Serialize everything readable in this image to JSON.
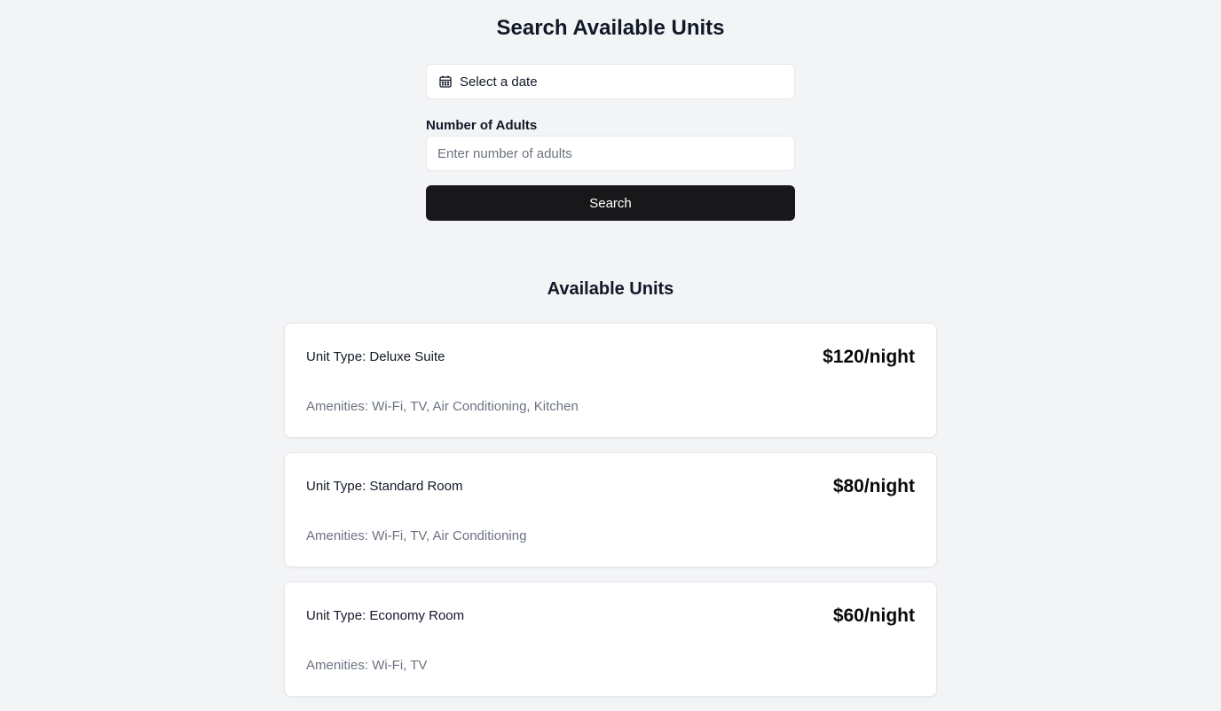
{
  "header": {
    "title": "Search Available Units"
  },
  "search": {
    "date_label": "Select a date",
    "adults_label": "Number of Adults",
    "adults_placeholder": "Enter number of adults",
    "adults_value": "",
    "button_label": "Search"
  },
  "results": {
    "title": "Available Units",
    "units": [
      {
        "type": "Unit Type: Deluxe Suite",
        "price": "$120/night",
        "amenities": "Amenities: Wi-Fi, TV, Air Conditioning, Kitchen"
      },
      {
        "type": "Unit Type: Standard Room",
        "price": "$80/night",
        "amenities": "Amenities: Wi-Fi, TV, Air Conditioning"
      },
      {
        "type": "Unit Type: Economy Room",
        "price": "$60/night",
        "amenities": "Amenities: Wi-Fi, TV"
      }
    ]
  },
  "icons": {
    "date_picker": "calendar-icon"
  },
  "colors": {
    "background": "#f3f4f6",
    "primary_button": "#18181b",
    "muted_text": "#6b7280"
  }
}
